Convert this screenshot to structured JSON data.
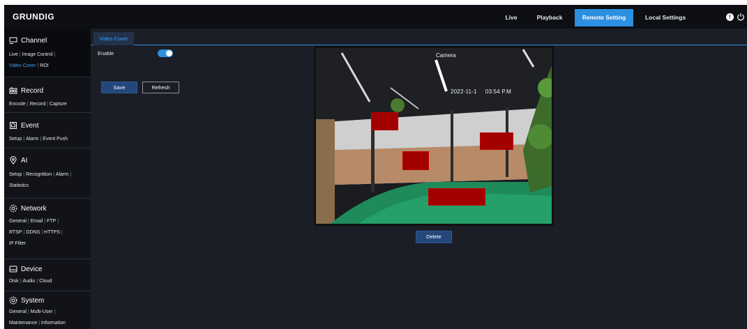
{
  "brand": {
    "logo": "GRUNDIG"
  },
  "topnav": {
    "items": [
      {
        "label": "Live",
        "active": false
      },
      {
        "label": "Playback",
        "active": false
      },
      {
        "label": "Remote Setting",
        "active": true
      },
      {
        "label": "Local Settings",
        "active": false
      }
    ],
    "accent_color": "#2d8fe0"
  },
  "sidebar": {
    "sections": [
      {
        "title": "Channel",
        "icon": "channel-icon",
        "links": [
          "Live",
          "Image Control",
          "Video Cover",
          "ROI"
        ],
        "selected": "Video Cover"
      },
      {
        "title": "Record",
        "icon": "record-icon",
        "links": [
          "Encode",
          "Record",
          "Capture"
        ]
      },
      {
        "title": "Event",
        "icon": "event-icon",
        "links": [
          "Setup",
          "Alarm",
          "Event Push"
        ]
      },
      {
        "title": "AI",
        "icon": "ai-icon",
        "links": [
          "Setup",
          "Recognition",
          "Alarm",
          "Statistics"
        ]
      },
      {
        "title": "Network",
        "icon": "network-icon",
        "links": [
          "General",
          "Email",
          "FTP",
          "RTSP",
          "DDNS",
          "HTTPS",
          "IP Filter"
        ]
      },
      {
        "title": "Device",
        "icon": "device-icon",
        "links": [
          "Disk",
          "Audio",
          "Cloud"
        ]
      },
      {
        "title": "System",
        "icon": "system-icon",
        "links": [
          "General",
          "Multi-User",
          "Maintenance",
          "Information"
        ]
      }
    ]
  },
  "content": {
    "tab": "Video Cover",
    "enable_label": "Enable",
    "enable_on": true,
    "save_label": "Save",
    "refresh_label": "Refresh",
    "delete_label": "Delete",
    "preview": {
      "camera_label": "Camera",
      "timestamp": "2022-11-1     03:54 P.M",
      "mask_count": 4,
      "mask_color": "#a30000"
    }
  }
}
